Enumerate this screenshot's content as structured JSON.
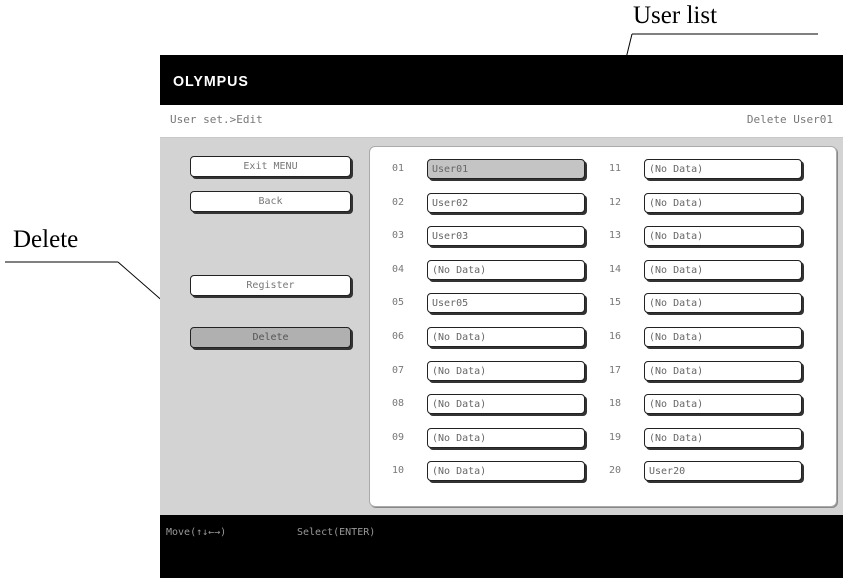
{
  "callouts": {
    "user_list": "User list",
    "delete": "Delete"
  },
  "header": {
    "logo": "OLYMPUS",
    "breadcrumb": "User set.>Edit",
    "mode": "Delete User01"
  },
  "menu": {
    "exit": "Exit MENU",
    "back": "Back",
    "register": "Register",
    "delete": "Delete"
  },
  "users": [
    {
      "id": "01",
      "name": "User01",
      "selected": true
    },
    {
      "id": "02",
      "name": "User02"
    },
    {
      "id": "03",
      "name": "User03"
    },
    {
      "id": "04",
      "name": "(No Data)"
    },
    {
      "id": "05",
      "name": "User05"
    },
    {
      "id": "06",
      "name": "(No Data)"
    },
    {
      "id": "07",
      "name": "(No Data)"
    },
    {
      "id": "08",
      "name": "(No Data)"
    },
    {
      "id": "09",
      "name": "(No Data)"
    },
    {
      "id": "10",
      "name": "(No Data)"
    },
    {
      "id": "11",
      "name": "(No Data)"
    },
    {
      "id": "12",
      "name": "(No Data)"
    },
    {
      "id": "13",
      "name": "(No Data)"
    },
    {
      "id": "14",
      "name": "(No Data)"
    },
    {
      "id": "15",
      "name": "(No Data)"
    },
    {
      "id": "16",
      "name": "(No Data)"
    },
    {
      "id": "17",
      "name": "(No Data)"
    },
    {
      "id": "18",
      "name": "(No Data)"
    },
    {
      "id": "19",
      "name": "(No Data)"
    },
    {
      "id": "20",
      "name": "User20"
    }
  ],
  "footer": {
    "move_hint": "Move(↑↓←→)",
    "select_hint": "Select(ENTER)"
  }
}
